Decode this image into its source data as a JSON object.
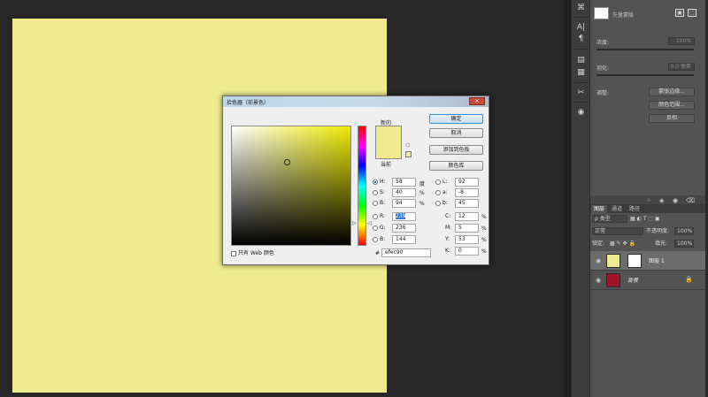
{
  "canvas": {
    "fill_color": "#efec90"
  },
  "properties": {
    "title": "矢量蒙版",
    "density_label": "浓度:",
    "density_value": "100%",
    "feather_label": "羽化:",
    "feather_value": "0.0 像素",
    "adjust_label": "调整:",
    "btn_mask_edge": "蒙版边缘...",
    "btn_color_range": "颜色范围...",
    "btn_invert": "反相"
  },
  "layers": {
    "tabs": [
      "图层",
      "通道",
      "路径"
    ],
    "kind_filter": "ρ 类型",
    "blend_mode": "正常",
    "opacity_label": "不透明度:",
    "opacity_value": "100%",
    "lock_label": "锁定:",
    "fill_label": "填充:",
    "fill_value": "100%",
    "items": [
      {
        "name": "图层 1",
        "thumb_color": "#efec90",
        "selected": true
      },
      {
        "name": "背景",
        "thumb_color": "#a3122a",
        "selected": false
      }
    ]
  },
  "dialog": {
    "title": "拾色器（前景色）",
    "close_glyph": "✕",
    "new_label": "新的",
    "current_label": "当前",
    "ok": "确定",
    "cancel": "取消",
    "add_swatch": "添加到色板",
    "color_libraries": "颜色库",
    "hsb": {
      "h_label": "H:",
      "h_value": "58",
      "h_unit": "度",
      "s_label": "S:",
      "s_value": "40",
      "s_unit": "%",
      "b_label": "B:",
      "b_value": "94",
      "b_unit": "%"
    },
    "rgb": {
      "r_label": "R:",
      "r_value": "239",
      "g_label": "G:",
      "g_value": "236",
      "b_label": "B:",
      "b_value": "144"
    },
    "lab": {
      "l_label": "L:",
      "l_value": "92",
      "a_label": "a:",
      "a_value": "-8",
      "b_label": "b:",
      "b_value": "45"
    },
    "cmyk": {
      "c_label": "C:",
      "c_value": "12",
      "m_label": "M:",
      "m_value": "5",
      "y_label": "Y:",
      "y_value": "53",
      "k_label": "K:",
      "k_value": "0",
      "unit": "%"
    },
    "web_only_label": "只有 Web 颜色",
    "hex_label": "#",
    "hex_value": "efec90",
    "new_color": "#efec90",
    "current_color": "#efec90"
  }
}
